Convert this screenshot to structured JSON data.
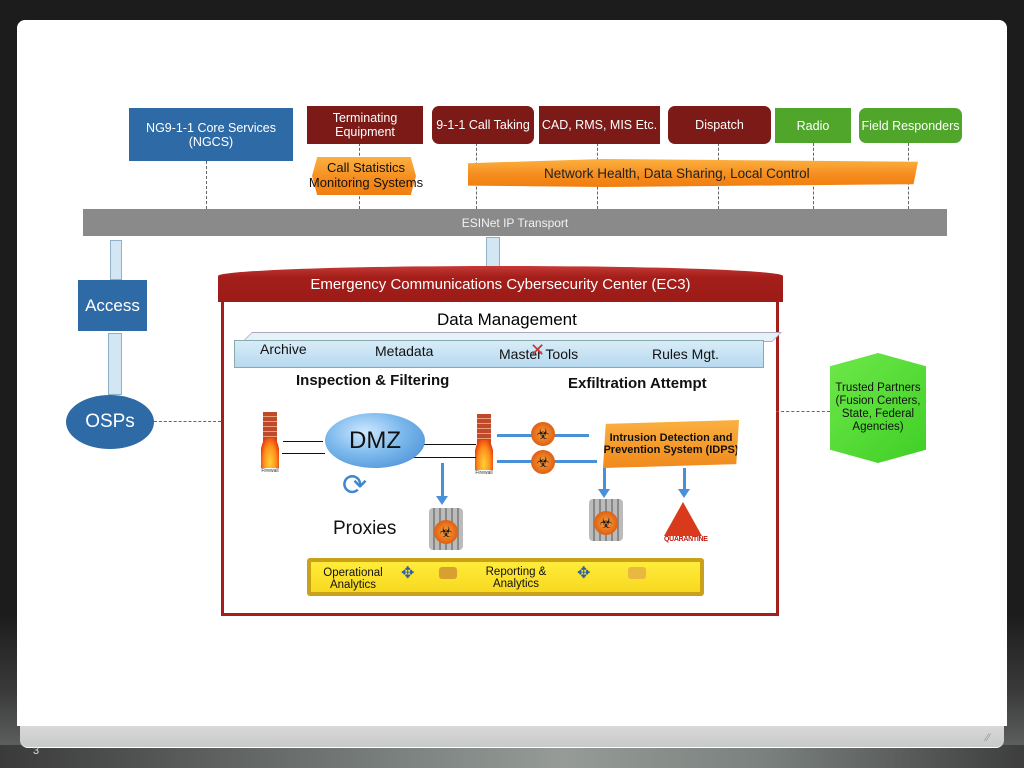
{
  "slide": {
    "page_number": "3"
  },
  "top_row": {
    "ngcs": "NG9-1-1 Core Services (NGCS)",
    "terminating_equipment": "Terminating Equipment",
    "call_taking": "9-1-1 Call Taking",
    "cad_rms_mis": "CAD, RMS, MIS Etc.",
    "dispatch": "Dispatch",
    "radio": "Radio",
    "field_responders": "Field Responders"
  },
  "banners": {
    "call_statistics": "Call Statistics Monitoring Systems",
    "network_health": "Network Health, Data Sharing, Local Control"
  },
  "esinet": "ESINet IP Transport",
  "left_column": {
    "access": "Access",
    "osps": "OSPs"
  },
  "ec3": {
    "title": "Emergency Communications Cybersecurity Center (EC3)",
    "data_management": {
      "title": "Data Management",
      "items": [
        "Archive",
        "Metadata",
        "Master Tools",
        "Rules Mgt."
      ]
    },
    "inspection_filtering": "Inspection & Filtering",
    "exfiltration_attempt": "Exfiltration Attempt",
    "dmz": "DMZ",
    "firewall_label": "Firewall",
    "proxies": "Proxies",
    "idps": "Intrusion Detection and Prevention System (IDPS)",
    "quarantine": "QUARANTINE",
    "analytics": {
      "operational": "Operational Analytics",
      "reporting": "Reporting & Analytics"
    }
  },
  "trusted_partners": "Trusted Partners (Fusion Centers, State, Federal Agencies)",
  "colors": {
    "blue": "#2e6aa6",
    "maroon": "#7b1a16",
    "green": "#4fa62a",
    "ec3_red": "#a41e1a",
    "orange": "#f58b1c",
    "yellow": "#f8d820"
  }
}
